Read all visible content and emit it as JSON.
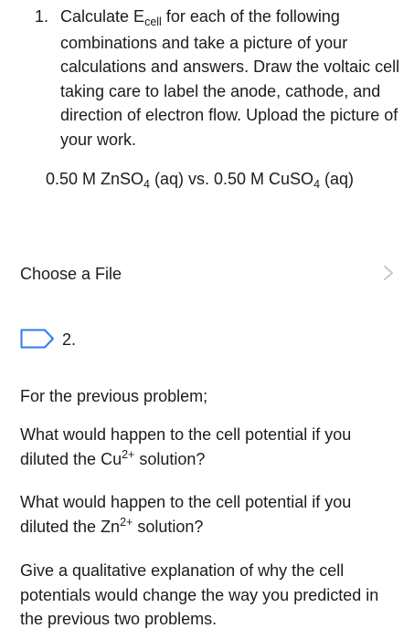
{
  "question1": {
    "number": "1.",
    "text_before_sub": "Calculate E",
    "subscript": "cell",
    "text_after_sub": " for each of the following combinations and take a picture of your calculations and answers.  Draw the voltaic cell taking care to label the anode, cathode, and direction of electron flow.  Upload the picture of your work."
  },
  "formula": {
    "part1": "0.50 M ZnSO",
    "sub1": "4",
    "part2": " (aq) vs. 0.50 M CuSO",
    "sub2": "4",
    "part3": " (aq)"
  },
  "file_upload": {
    "label": "Choose a File",
    "icon": "chevron-right-icon"
  },
  "question2": {
    "number": "2.",
    "flag_icon": "flag-icon",
    "intro": "For the previous problem;",
    "p1_before": "What would happen to the cell potential if you diluted the Cu",
    "p1_sup": "2+",
    "p1_after": " solution?",
    "p2_before": "What would happen to the cell potential if you diluted the Zn",
    "p2_sup": "2+",
    "p2_after": " solution?",
    "p3": "Give a qualitative explanation of why the cell potentials would change the way you predicted in the previous two problems."
  },
  "colors": {
    "flag": "#2f7bf6",
    "chevron": "#c7c7cc",
    "text": "#1c1c1e"
  }
}
